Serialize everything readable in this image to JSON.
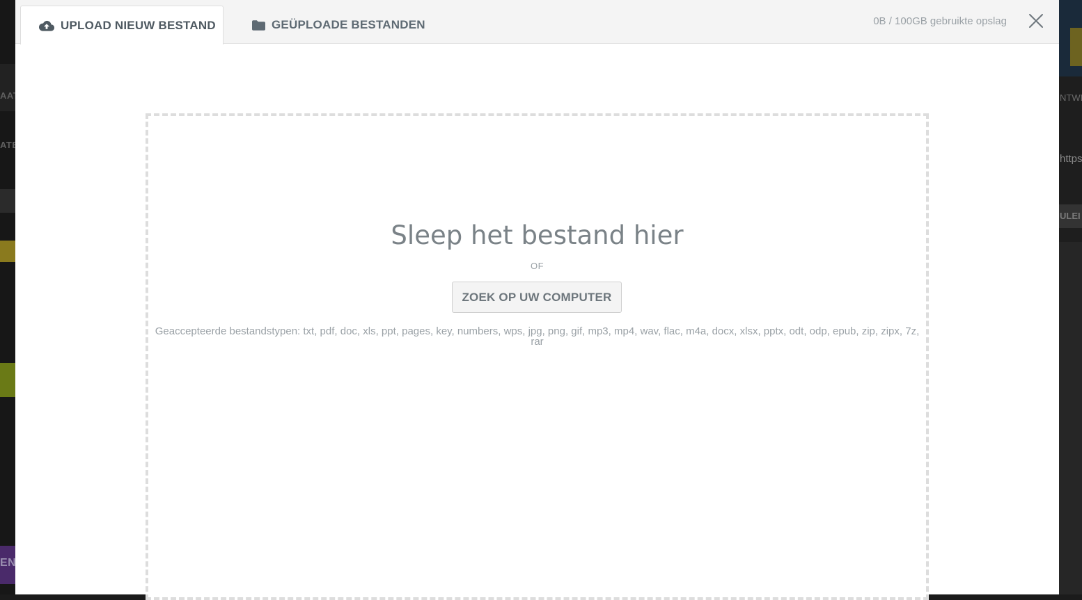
{
  "modal": {
    "tabs": [
      {
        "label": "UPLOAD NIEUW BESTAND",
        "icon": "cloud-upload-icon",
        "active": true
      },
      {
        "label": "GEÜPLOADE BESTANDEN",
        "icon": "folder-icon",
        "active": false
      }
    ],
    "storage_info": "0B / 100GB gebruikte opslag",
    "close_icon": "close-icon"
  },
  "dropzone": {
    "title": "Sleep het bestand hier",
    "or_label": "OF",
    "browse_button": "ZOEK OP UW COMPUTER",
    "accepted_types": "Geaccepteerde bestandstypen: txt, pdf, doc, xls, ppt, pages, key, numbers, wps, jpg, png, gif, mp3, mp4, wav, flac, m4a, docx, xlsx, pptx, odt, odp, epub, zip, zipx, 7z, rar"
  },
  "background": {
    "left_fragments": [
      "AAT",
      "ATE",
      "EN"
    ],
    "right_fragments": [
      "NTWI",
      "https",
      "ULEI"
    ]
  },
  "colors": {
    "header_bg": "#f4f4f4",
    "tab_text": "#5e6a73",
    "muted_text": "#9aa1a6",
    "dropzone_border": "#dddddd",
    "bg_yellow": "#8a7a1e",
    "bg_green": "#6a7a16",
    "bg_purple": "#4a2a6a"
  }
}
